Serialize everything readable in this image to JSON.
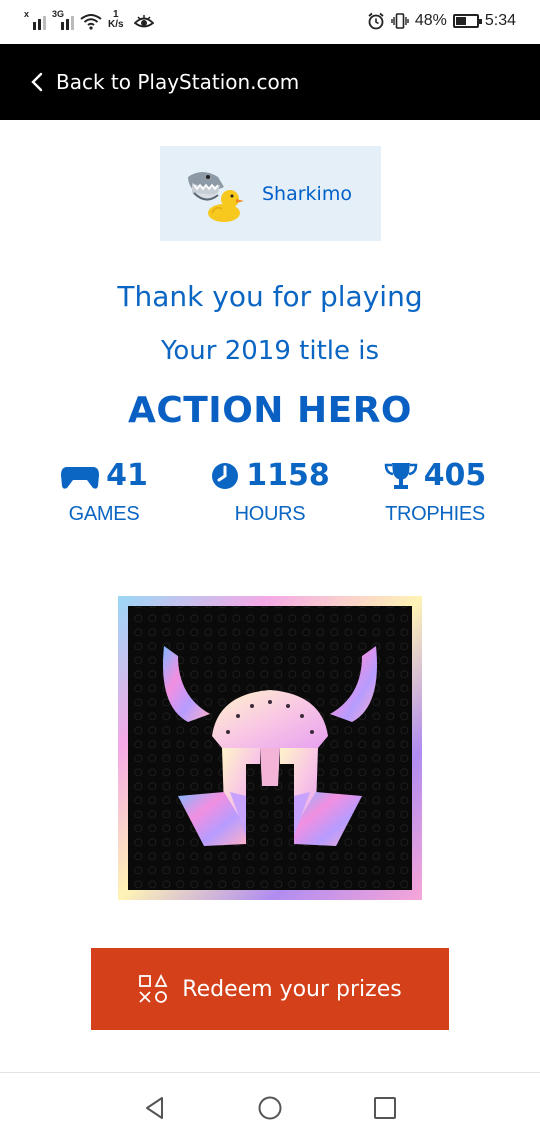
{
  "status_bar": {
    "sim1_tag": "x",
    "sim2_tag": "3G",
    "speed_value": "1",
    "speed_unit": "K/s",
    "battery_percent": "48%",
    "battery_level": 0.48,
    "time": "5:34"
  },
  "header": {
    "back_label": "Back to PlayStation.com"
  },
  "profile": {
    "username": "Sharkimo"
  },
  "summary": {
    "thank_you": "Thank you for playing",
    "subtitle": "Your 2019 title is",
    "title": "ACTION HERO"
  },
  "stats": [
    {
      "value": "41",
      "label": "GAMES",
      "icon": "gamepad-icon"
    },
    {
      "value": "1158",
      "label": "HOURS",
      "icon": "clock-icon"
    },
    {
      "value": "405",
      "label": "TROPHIES",
      "icon": "trophy-icon"
    }
  ],
  "cta": {
    "label": "Redeem your prizes",
    "icon": "playstation-shapes-icon"
  },
  "nav": {
    "back": "back-icon",
    "home": "home-icon",
    "recents": "recents-icon"
  },
  "colors": {
    "brand_blue": "#0b66c3",
    "cta_orange": "#d3401a",
    "profile_bg": "#e5eff8"
  }
}
